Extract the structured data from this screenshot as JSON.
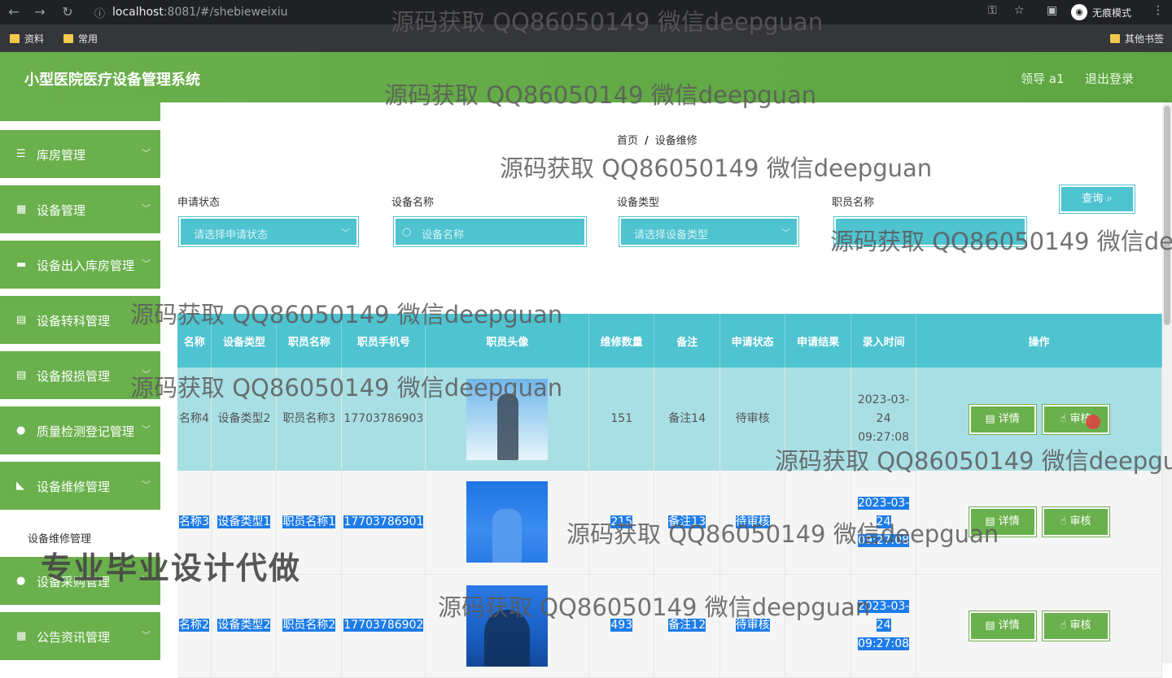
{
  "browser": {
    "url_host": "localhost",
    "url_rest": ":8081/#/shebieweixiu",
    "incognito_label": "无痕模式",
    "bookmarks": [
      "资料",
      "常用"
    ],
    "other_bookmarks": "其他书签"
  },
  "header": {
    "title": "小型医院医疗设备管理系统",
    "user": "领导 a1",
    "logout": "退出登录"
  },
  "sidebar": {
    "items": [
      {
        "label": "库房管理",
        "icon": "list-icon"
      },
      {
        "label": "设备管理",
        "icon": "grid-icon"
      },
      {
        "label": "设备出入库房管理",
        "icon": "monitor-icon"
      },
      {
        "label": "设备转科管理",
        "icon": "clipboard-icon"
      },
      {
        "label": "设备报损管理",
        "icon": "document-icon"
      },
      {
        "label": "质量检测登记管理",
        "icon": "user-icon"
      },
      {
        "label": "设备维修管理",
        "icon": "wrench-icon"
      },
      {
        "label": "设备采购管理",
        "icon": "pin-icon"
      },
      {
        "label": "公告资讯管理",
        "icon": "grid-icon"
      }
    ],
    "submenu_active": "设备维修管理"
  },
  "breadcrumb": {
    "home": "首页",
    "current": "设备维修"
  },
  "filters": {
    "status_label": "申请状态",
    "status_placeholder": "请选择申请状态",
    "name_label": "设备名称",
    "name_placeholder": "设备名称",
    "type_label": "设备类型",
    "type_placeholder": "请选择设备类型",
    "staff_label": "职员名称",
    "query_button": "查询"
  },
  "table": {
    "columns": [
      "名称",
      "设备类型",
      "职员名称",
      "职员手机号",
      "职员头像",
      "维修数量",
      "备注",
      "申请状态",
      "申请结果",
      "录入时间",
      "操作"
    ],
    "rows": [
      {
        "name": "名称4",
        "type": "设备类型2",
        "staff": "职员名称3",
        "phone": "17703786903",
        "qty": "151",
        "note": "备注14",
        "status": "待审核",
        "result": "",
        "time": "2023-03-24 09:27:08"
      },
      {
        "name": "名称3",
        "type": "设备类型1",
        "staff": "职员名称1",
        "phone": "17703786901",
        "qty": "215",
        "note": "备注13",
        "status": "待审核",
        "result": "",
        "time": "2023-03-24 09:27:08"
      },
      {
        "name": "名称2",
        "type": "设备类型2",
        "staff": "职员名称2",
        "phone": "17703786902",
        "qty": "493",
        "note": "备注12",
        "status": "待审核",
        "result": "",
        "time": "2023-03-24 09:27:08"
      }
    ],
    "detail_button": "详情",
    "audit_button": "审核"
  },
  "watermarks": {
    "text": "源码获取 QQ86050149 微信deepguan",
    "text_cut_a": "源码获取 QQ86050149 微信de",
    "text_cut_b": "源码获取 QQ86050149 微信deepgu",
    "promo": "专业毕业设计代做"
  }
}
